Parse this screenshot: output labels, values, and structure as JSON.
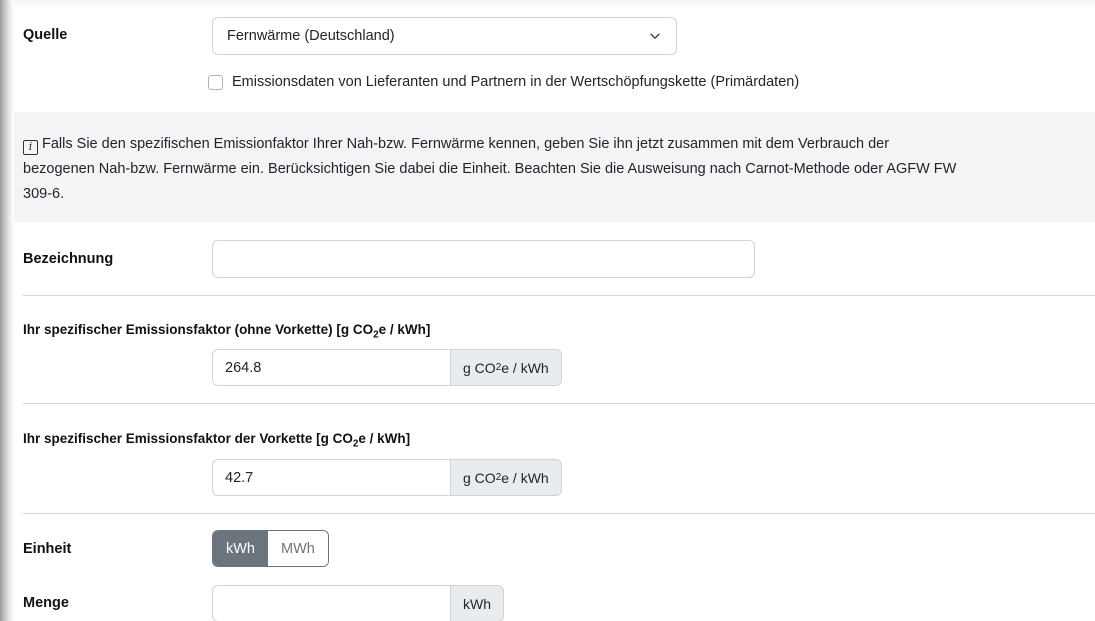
{
  "source": {
    "label": "Quelle",
    "selected": "Fernwärme (Deutschland)",
    "icon": "chevron-down-icon"
  },
  "primary_data": {
    "label": "Emissionsdaten von Lieferanten und Partnern in der Wertschöpfungskette (Primärdaten)",
    "checked": false
  },
  "info": {
    "icon": "info-icon",
    "lines": [
      "Falls Sie den spezifischen Emissionfaktor Ihrer Nah-bzw. Fernwärme kennen, geben Sie ihn jetzt zusammen mit dem Verbrauch der",
      "bezogenen Nah-bzw. Fernwärme ein. Berücksichtigen Sie dabei die Einheit. Beachten Sie die Ausweisung nach Carnot-Methode oder AGFW FW",
      "309-6."
    ]
  },
  "designation": {
    "label": "Bezeichnung",
    "value": ""
  },
  "factor_direct": {
    "label_prefix": "Ihr spezifischer Emissionsfaktor (ohne Vorkette) [g CO",
    "label_sub": "2",
    "label_suffix": "e / kWh]",
    "value": "264.8",
    "unit_prefix": "g CO",
    "unit_sub": "2",
    "unit_suffix": "e / kWh"
  },
  "factor_upstream": {
    "label_prefix": "Ihr spezifischer Emissionsfaktor der Vorkette [g CO",
    "label_sub": "2",
    "label_suffix": "e / kWh]",
    "value": "42.7",
    "unit_prefix": "g CO",
    "unit_sub": "2",
    "unit_suffix": "e / kWh"
  },
  "unit": {
    "label": "Einheit",
    "options": [
      "kWh",
      "MWh"
    ],
    "selected": "kWh"
  },
  "amount": {
    "label": "Menge",
    "value": "",
    "unit": "kWh"
  },
  "colors": {
    "active_toggle": "#6c757d",
    "info_background": "#f3f4f6",
    "addon_background": "#e9ecef"
  }
}
